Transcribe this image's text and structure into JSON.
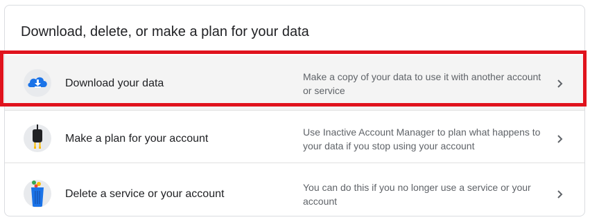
{
  "card": {
    "title": "Download, delete, or make a plan for your data"
  },
  "rows": [
    {
      "label": "Download your data",
      "description": "Make a copy of your data to use it with another account or service",
      "icon": "cloud-download-icon",
      "selected": true
    },
    {
      "label": "Make a plan for your account",
      "description": "Use Inactive Account Manager to plan what happens to your data if you stop using your account",
      "icon": "power-plug-icon"
    },
    {
      "label": "Delete a service or your account",
      "description": "You can do this if you no longer use a service or your account",
      "icon": "trash-can-icon"
    }
  ],
  "colors": {
    "highlight": "#e0131d",
    "google_blue": "#1a73e8",
    "selected_row_bg": "#f4f4f4"
  }
}
